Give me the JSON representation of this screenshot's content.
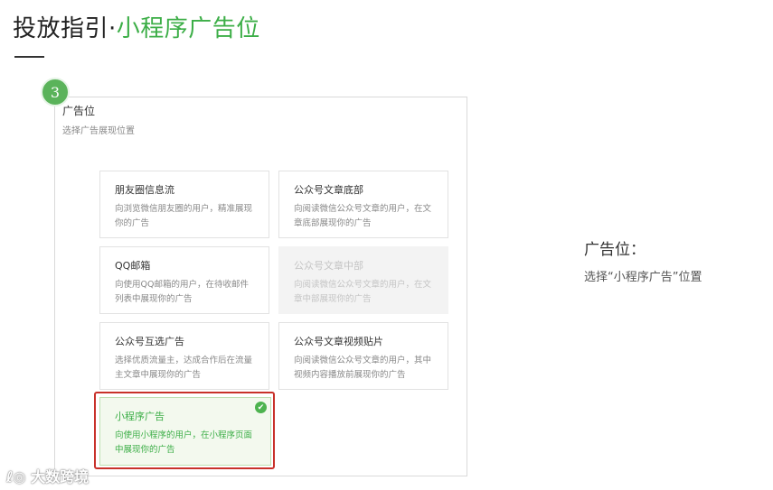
{
  "header": {
    "title_main": "投放指引",
    "title_separator": "·",
    "title_accent": "小程序广告位"
  },
  "step": {
    "number": "3"
  },
  "panel": {
    "heading": "广告位",
    "subheading": "选择广告展现位置",
    "cards": [
      {
        "title": "朋友圈信息流",
        "desc": "向浏览微信朋友圈的用户，精准展现你的广告",
        "state": "normal"
      },
      {
        "title": "公众号文章底部",
        "desc": "向阅读微信公众号文章的用户，在文章底部展现你的广告",
        "state": "normal"
      },
      {
        "title": "QQ邮箱",
        "desc": "向使用QQ邮箱的用户，在待收邮件列表中展现你的广告",
        "state": "normal"
      },
      {
        "title": "公众号文章中部",
        "desc": "向阅读微信公众号文章的用户，在文章中部展现你的广告",
        "state": "disabled"
      },
      {
        "title": "公众号互选广告",
        "desc": "选择优质流量主，达成合作后在流量主文章中展现你的广告",
        "state": "normal"
      },
      {
        "title": "公众号文章视频贴片",
        "desc": "向阅读微信公众号文章的用户，其中视频内容播放前展现你的广告",
        "state": "normal"
      },
      {
        "title": "小程序广告",
        "desc": "向使用小程序的用户，在小程序页面中展现你的广告",
        "state": "selected"
      }
    ]
  },
  "sidebar_note": {
    "title": "广告位：",
    "desc": "选择“小程序广告”位置"
  },
  "watermark": {
    "text": "大数跨境"
  },
  "colors": {
    "accent_green": "#3cae47",
    "highlight_red": "#c8312a"
  }
}
